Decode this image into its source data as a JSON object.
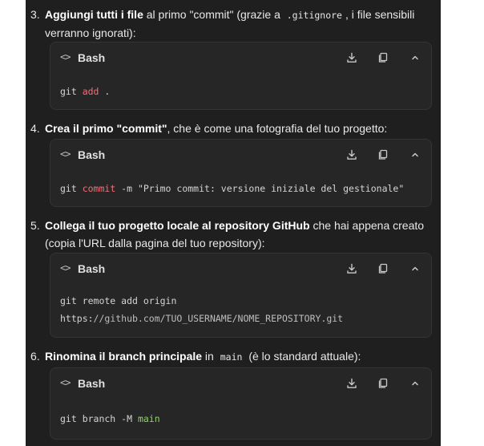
{
  "steps": [
    {
      "number": "3.",
      "bold": "Aggiungi tutti i file",
      "text_before_code": " al primo \"commit\" (grazie a ",
      "inline_code": ".gitignore",
      "text_after_code": ", i file sensibili verranno ignorati):",
      "code": {
        "language": "Bash",
        "lines": [
          {
            "cmd": "git ",
            "kw": "add",
            "rest": " ."
          }
        ]
      }
    },
    {
      "number": "4.",
      "bold": "Crea il primo \"commit\"",
      "text": ", che è come una fotografia del tuo progetto:",
      "code": {
        "language": "Bash",
        "lines": [
          {
            "cmd": "git ",
            "kw": "commit",
            "rest": " -m \"Primo commit: versione iniziale del gestionale\""
          }
        ]
      }
    },
    {
      "number": "5.",
      "bold": "Collega il tuo progetto locale al repository GitHub",
      "text": " che hai appena creato (copia l'URL dalla pagina del tuo repository):",
      "code": {
        "language": "Bash",
        "lines": [
          {
            "plain": "git remote add origin"
          },
          {
            "prefix": "https:",
            "url": "//github.com/TUO_USERNAME/NOME_REPOSITORY.git"
          }
        ]
      }
    },
    {
      "number": "6.",
      "bold": "Rinomina il branch principale",
      "text_before_code": " in ",
      "inline_code": "main",
      "text_after_code": " (è lo standard attuale):",
      "code": {
        "language": "Bash",
        "lines": [
          {
            "cmd": "git branch -M ",
            "kw": "main"
          }
        ]
      }
    }
  ],
  "icons": {
    "lang": "code-brackets-icon",
    "download": "download-icon",
    "copy": "copy-icon",
    "collapse": "chevron-up-icon"
  },
  "colors": {
    "panel_bg": "#1f1f1f",
    "block_bg": "#262626",
    "keyword_red": "#f07178",
    "keyword_green": "#8fd16b"
  }
}
